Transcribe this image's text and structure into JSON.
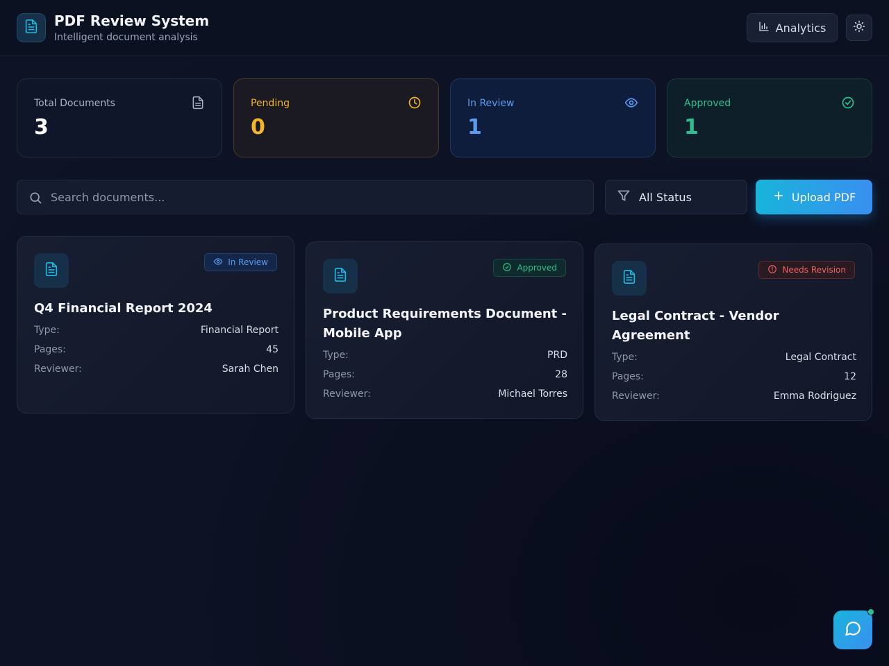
{
  "header": {
    "title": "PDF Review System",
    "subtitle": "Intelligent document analysis",
    "analytics_label": "Analytics",
    "logo_icon": "file-text-icon",
    "theme_icon": "sun-icon"
  },
  "stats": [
    {
      "label": "Total Documents",
      "value": "3",
      "icon": "file-text-icon"
    },
    {
      "label": "Pending",
      "value": "0",
      "icon": "clock-icon",
      "color": "#f4b526"
    },
    {
      "label": "In Review",
      "value": "1",
      "icon": "eye-icon",
      "color": "#5a9cf0"
    },
    {
      "label": "Approved",
      "value": "1",
      "icon": "check-circle-icon",
      "color": "#2bc08d"
    }
  ],
  "toolbar": {
    "search_placeholder": "Search documents...",
    "filter_label": "All Status",
    "upload_label": "Upload PDF"
  },
  "field_labels": {
    "type": "Type:",
    "pages": "Pages:",
    "reviewer": "Reviewer:"
  },
  "documents": [
    {
      "title": "Q4 Financial Report 2024",
      "status": "In Review",
      "type": "Financial Report",
      "pages": "45",
      "reviewer": "Sarah Chen"
    },
    {
      "title": "Product Requirements Document - Mobile App",
      "status": "Approved",
      "type": "PRD",
      "pages": "28",
      "reviewer": "Michael Torres"
    },
    {
      "title": "Legal Contract - Vendor Agreement",
      "status": "Needs Revision",
      "type": "Legal Contract",
      "pages": "12",
      "reviewer": "Emma Rodriguez"
    }
  ],
  "colors": {
    "accent": "#18b4db",
    "pending": "#f4b526",
    "in_review": "#5a9cf0",
    "approved": "#2bc08d",
    "needs_revision": "#f06161"
  }
}
